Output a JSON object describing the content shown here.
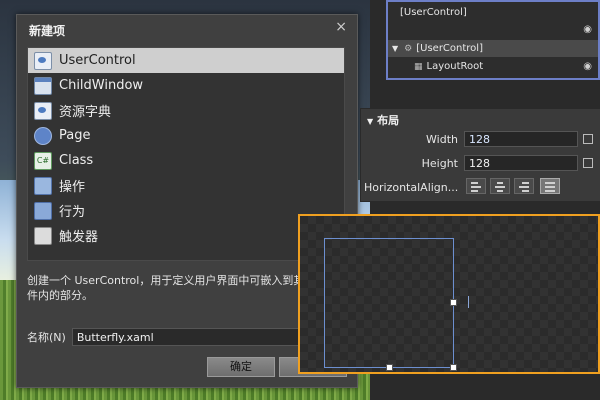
{
  "dialog": {
    "title": "新建项",
    "close": "×",
    "items": [
      {
        "label": "UserControl",
        "icon": "usercontrol-icon",
        "selected": true
      },
      {
        "label": "ChildWindow",
        "icon": "childwindow-icon"
      },
      {
        "label": "资源字典",
        "icon": "resource-dictionary-icon"
      },
      {
        "label": "Page",
        "icon": "page-icon"
      },
      {
        "label": "Class",
        "icon": "class-icon"
      },
      {
        "label": "操作",
        "icon": "action-icon"
      },
      {
        "label": "行为",
        "icon": "behavior-icon"
      },
      {
        "label": "触发器",
        "icon": "trigger-icon"
      }
    ],
    "description": "创建一个 UserControl，用于定义用户界面中可嵌入到其他\n件内的部分。",
    "name_label": "名称(N)",
    "name_value": "Butterfly.xaml",
    "ok_label": "确定",
    "cancel_label": ""
  },
  "objects": {
    "rows": [
      {
        "label": "[UserControl]"
      },
      {
        "label": "[UserControl]"
      },
      {
        "label": "LayoutRoot"
      }
    ]
  },
  "properties": {
    "header": "布局",
    "width_label": "Width",
    "width_value": "128",
    "height_label": "Height",
    "height_value": "128",
    "halign_label": "HorizontalAlign..."
  },
  "colors": {
    "accent_orange": "#f0a020",
    "accent_blue": "#6d7fc7",
    "selection_bg": "#cfcfcf"
  }
}
